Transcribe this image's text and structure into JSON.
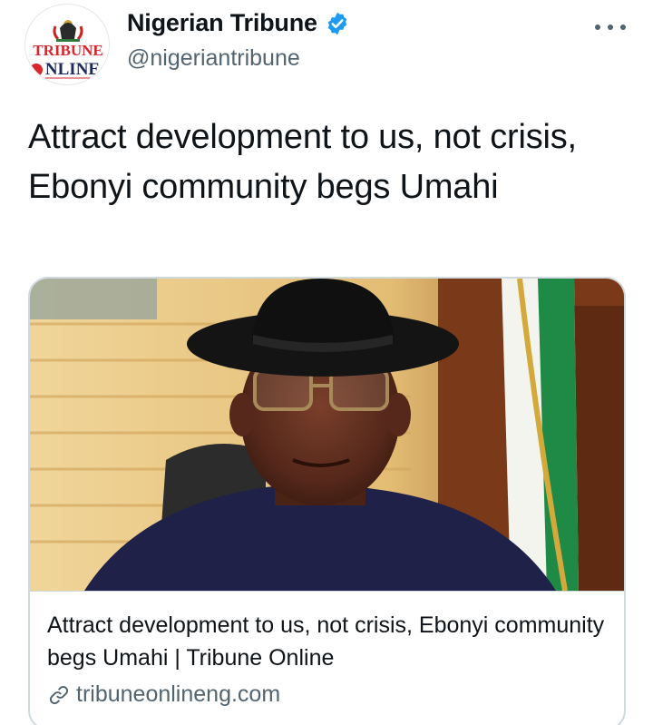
{
  "account": {
    "display_name": "Nigerian Tribune",
    "handle": "@nigeriantribune",
    "verified": true,
    "avatar_lines": [
      "TRIBUNE",
      "NLINE"
    ],
    "avatar_icon": "coat-of-arms-icon"
  },
  "tweet": {
    "text": "Attract development to us, not crisis, Ebonyi community begs Umahi"
  },
  "card": {
    "title": "Attract development to us, not crisis, Ebonyi community begs Umahi | Tribune Online",
    "domain": "tribuneonlineng.com",
    "domain_icon": "link-icon",
    "image": "photo-of-man-in-black-hat-and-glasses"
  },
  "colors": {
    "verified_blue": "#1d9bf0",
    "secondary_text": "#536471",
    "card_border": "#cfd9de",
    "brand_red": "#d7262c",
    "brand_navy": "#1c2a5a"
  }
}
